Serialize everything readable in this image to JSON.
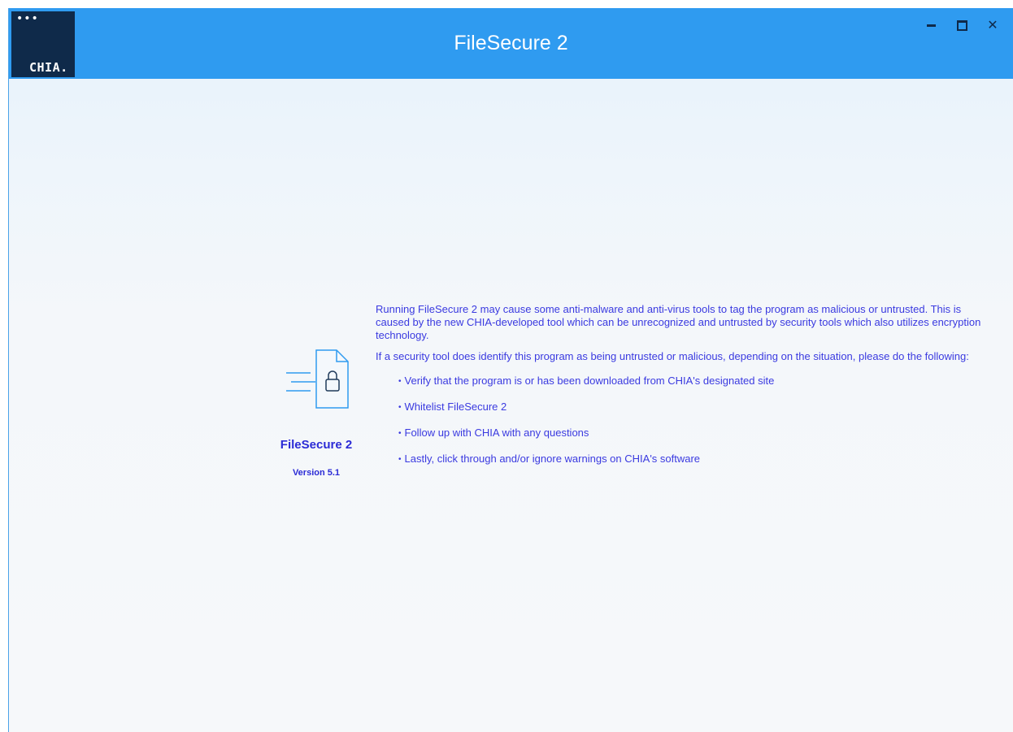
{
  "window": {
    "title": "FileSecure 2",
    "controls": {
      "minimize": "minimize-icon",
      "maximize": "maximize-icon",
      "close": "close-icon"
    }
  },
  "logo": {
    "dots": "•••",
    "text": "CHIA."
  },
  "product": {
    "name": "FileSecure 2",
    "version": "Version 5.1",
    "icon": "secure-file-icon"
  },
  "message": {
    "paragraph1": "Running FileSecure 2 may cause some anti-malware and anti-virus tools to tag the program as malicious or untrusted. This is caused by the new CHIA-developed tool which can be unrecognized and untrusted by security tools which also utilizes encryption technology.",
    "paragraph2": "If a security tool does identify this program as being untrusted or malicious, depending on the situation, please do the following:",
    "bullets": [
      "Verify that the program is or has been downloaded from CHIA's designated site",
      "Whitelist FileSecure 2",
      "Follow up with CHIA with any questions",
      "Lastly, click through and/or ignore warnings on CHIA's software"
    ]
  },
  "colors": {
    "titlebar": "#2f9bf0",
    "logo_bg": "#0f2a4a",
    "text": "#3a3ae0",
    "icon_stroke": "#2f9bf0"
  }
}
